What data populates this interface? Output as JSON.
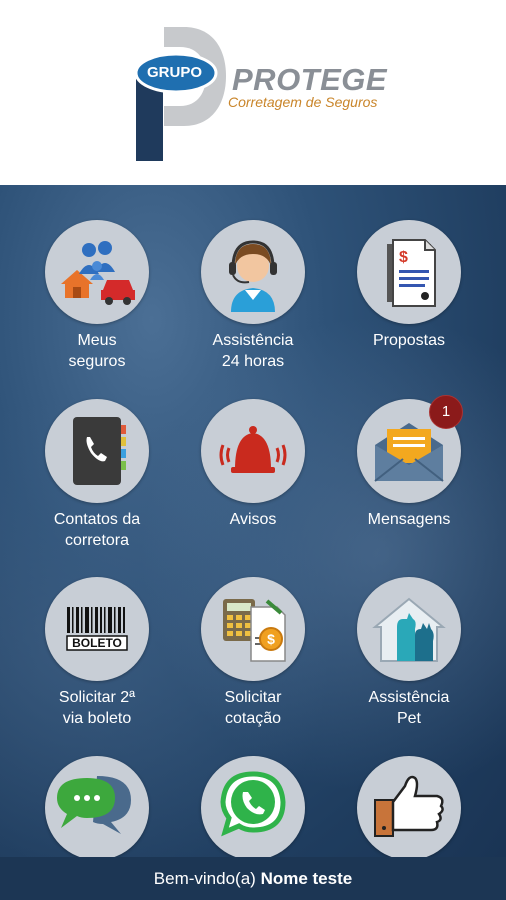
{
  "header": {
    "logo_grupo": "GRUPO",
    "logo_main": "PROTEGE",
    "logo_sub": "Corretagem de Seguros"
  },
  "tiles": [
    {
      "id": "meus-seguros",
      "line1": "Meus",
      "line2": "seguros",
      "icon": "family-house-car-icon"
    },
    {
      "id": "assistencia-24",
      "line1": "Assistência",
      "line2": "24 horas",
      "icon": "headset-agent-icon"
    },
    {
      "id": "propostas",
      "line1": "Propostas",
      "line2": "",
      "icon": "document-dollar-icon"
    },
    {
      "id": "contatos",
      "line1": "Contatos da",
      "line2": "corretora",
      "icon": "phone-book-icon"
    },
    {
      "id": "avisos",
      "line1": "Avisos",
      "line2": "",
      "icon": "alarm-bell-icon"
    },
    {
      "id": "mensagens",
      "line1": "Mensagens",
      "line2": "",
      "icon": "envelope-icon",
      "badge": "1"
    },
    {
      "id": "boleto",
      "line1": "Solicitar 2ª",
      "line2": "via boleto",
      "icon": "barcode-boleto-icon",
      "icon_text": "BOLETO"
    },
    {
      "id": "cotacao",
      "line1": "Solicitar",
      "line2": "cotação",
      "icon": "calculator-coin-icon"
    },
    {
      "id": "pet",
      "line1": "Assistência",
      "line2": "Pet",
      "icon": "pet-house-icon"
    },
    {
      "id": "chat",
      "line1": "",
      "line2": "",
      "icon": "chat-bubbles-icon"
    },
    {
      "id": "whatsapp",
      "line1": "",
      "line2": "",
      "icon": "whatsapp-icon"
    },
    {
      "id": "like",
      "line1": "",
      "line2": "",
      "icon": "thumbs-up-icon"
    }
  ],
  "footer": {
    "greeting": "Bem-vindo(a)",
    "user_name": "Nome teste"
  },
  "colors": {
    "background_blue": "#1f3d5f",
    "circle_gray": "#c8ced6",
    "badge_red": "#8b1a1a",
    "logo_navy": "#1f3a5c"
  }
}
